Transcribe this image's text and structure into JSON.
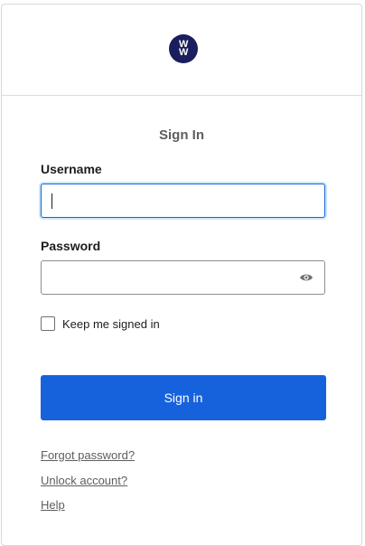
{
  "brand": {
    "logo_line1": "W",
    "logo_line2": "W",
    "color": "#1a1d5e"
  },
  "form": {
    "title": "Sign In",
    "username": {
      "label": "Username",
      "value": "",
      "placeholder": ""
    },
    "password": {
      "label": "Password",
      "value": "",
      "placeholder": "",
      "toggle_icon": "eye-icon"
    },
    "remember": {
      "label": "Keep me signed in",
      "checked": false
    },
    "submit_label": "Sign in",
    "accent_color": "#1662dd"
  },
  "links": {
    "forgot_password": "Forgot password?",
    "unlock_account": "Unlock account?",
    "help": "Help"
  }
}
